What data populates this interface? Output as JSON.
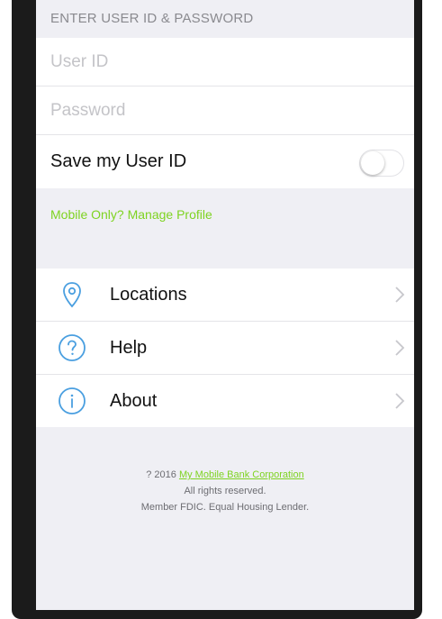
{
  "login": {
    "header": "ENTER USER ID & PASSWORD",
    "user_id_placeholder": "User ID",
    "password_placeholder": "Password",
    "save_user_id_label": "Save my User ID",
    "save_user_id_on": false
  },
  "manage_profile_link": "Mobile Only? Manage Profile",
  "menu": {
    "items": [
      {
        "label": "Locations",
        "icon": "location-pin-icon"
      },
      {
        "label": "Help",
        "icon": "question-icon"
      },
      {
        "label": "About",
        "icon": "info-icon"
      }
    ]
  },
  "footer": {
    "copyright_prefix": "? 2016",
    "company_link": "My Mobile Bank Corporation",
    "rights": "All rights reserved.",
    "member": "Member FDIC. Equal Housing Lender."
  },
  "colors": {
    "accent_green": "#7ed321",
    "icon_blue": "#4a9fe0",
    "background": "#efeff4"
  }
}
